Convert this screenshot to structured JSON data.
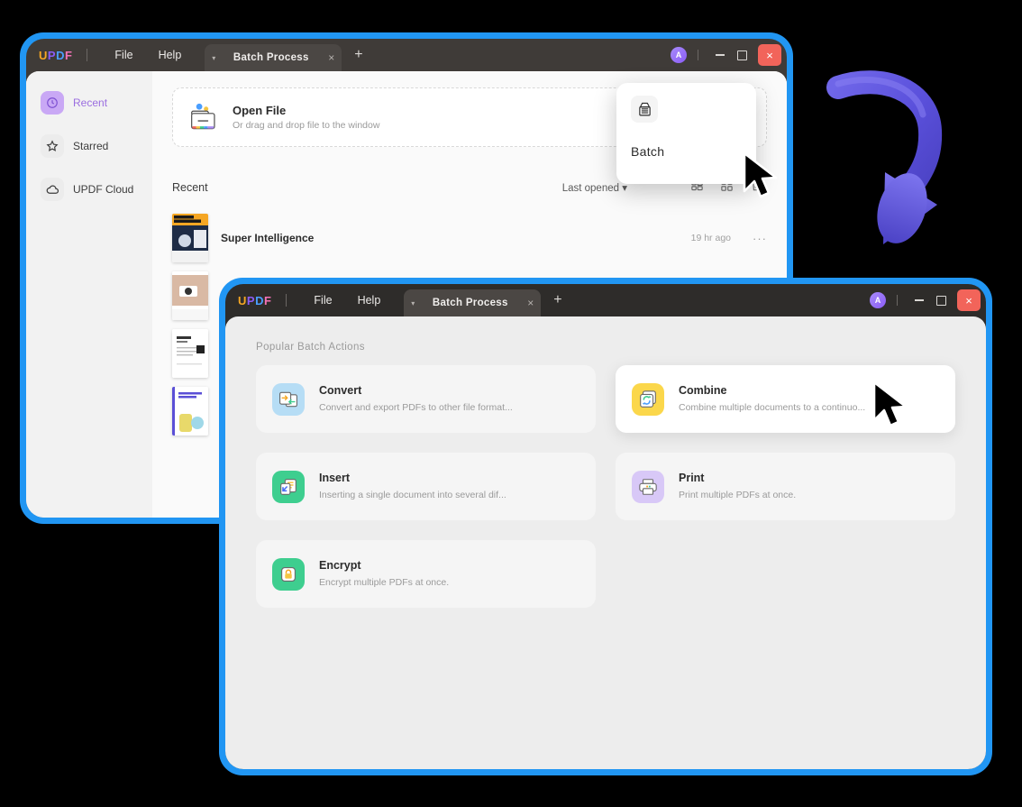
{
  "app": {
    "logo": {
      "l1": "U",
      "l2": "P",
      "l3": "D",
      "l4": "F"
    },
    "accent_blue": "#2196f3",
    "accent_purple": "#8b5cf6",
    "close_red": "#f2645a"
  },
  "window1": {
    "menu": {
      "file": "File",
      "help": "Help"
    },
    "tab": {
      "label": "Batch Process",
      "close": "×",
      "caret": "▾"
    },
    "new_tab": "+",
    "avatar_initial": "A",
    "controls": {
      "minimize": "minimize-button",
      "maximize": "maximize-button",
      "close": "×"
    },
    "sidebar": {
      "items": [
        {
          "label": "Recent",
          "icon": "clock-icon",
          "active": true
        },
        {
          "label": "Starred",
          "icon": "star-icon",
          "active": false
        },
        {
          "label": "UPDF Cloud",
          "icon": "cloud-icon",
          "active": false
        }
      ]
    },
    "open_file": {
      "title": "Open File",
      "subtitle": "Or drag and drop file to the window",
      "go_label": "›"
    },
    "recent": {
      "heading": "Recent",
      "sort_label": "Last opened",
      "sort_caret": "▾",
      "icons": [
        "list-view-icon",
        "grid-view-icon",
        "trash-icon"
      ],
      "items": [
        {
          "name": "Super Intelligence",
          "time": "19 hr ago",
          "more": "···"
        },
        {
          "name": "",
          "time": "",
          "more": ""
        },
        {
          "name": "",
          "time": "",
          "more": ""
        },
        {
          "name": "",
          "time": "",
          "more": ""
        }
      ]
    },
    "batch_popup": {
      "label": "Batch",
      "icon": "batch-stack-icon"
    }
  },
  "window2": {
    "menu": {
      "file": "File",
      "help": "Help"
    },
    "tab": {
      "label": "Batch Process",
      "close": "×",
      "caret": "▾"
    },
    "new_tab": "+",
    "avatar_initial": "A",
    "controls": {
      "minimize": "minimize-button",
      "maximize": "maximize-button",
      "close": "×"
    },
    "section_title": "Popular Batch Actions",
    "cards": [
      {
        "title": "Convert",
        "desc": "Convert and export PDFs to other file format...",
        "icon": "convert-icon",
        "icon_bg": "#b6ddf5",
        "hover": false
      },
      {
        "title": "Combine",
        "desc": "Combine multiple documents to a continuo...",
        "icon": "combine-icon",
        "icon_bg": "#fbd74b",
        "hover": true
      },
      {
        "title": "Insert",
        "desc": "Inserting a single document into several dif...",
        "icon": "insert-icon",
        "icon_bg": "#3ece8f",
        "hover": false
      },
      {
        "title": "Print",
        "desc": "Print multiple PDFs at once.",
        "icon": "print-icon",
        "icon_bg": "#d8c8f7",
        "hover": false
      },
      {
        "title": "Encrypt",
        "desc": "Encrypt multiple PDFs at once.",
        "icon": "encrypt-icon",
        "icon_bg": "#3ece8f",
        "hover": false
      }
    ]
  },
  "decoration": {
    "arrow": "curved-down-arrow-3d",
    "arrow_color": "#5a51d6"
  }
}
